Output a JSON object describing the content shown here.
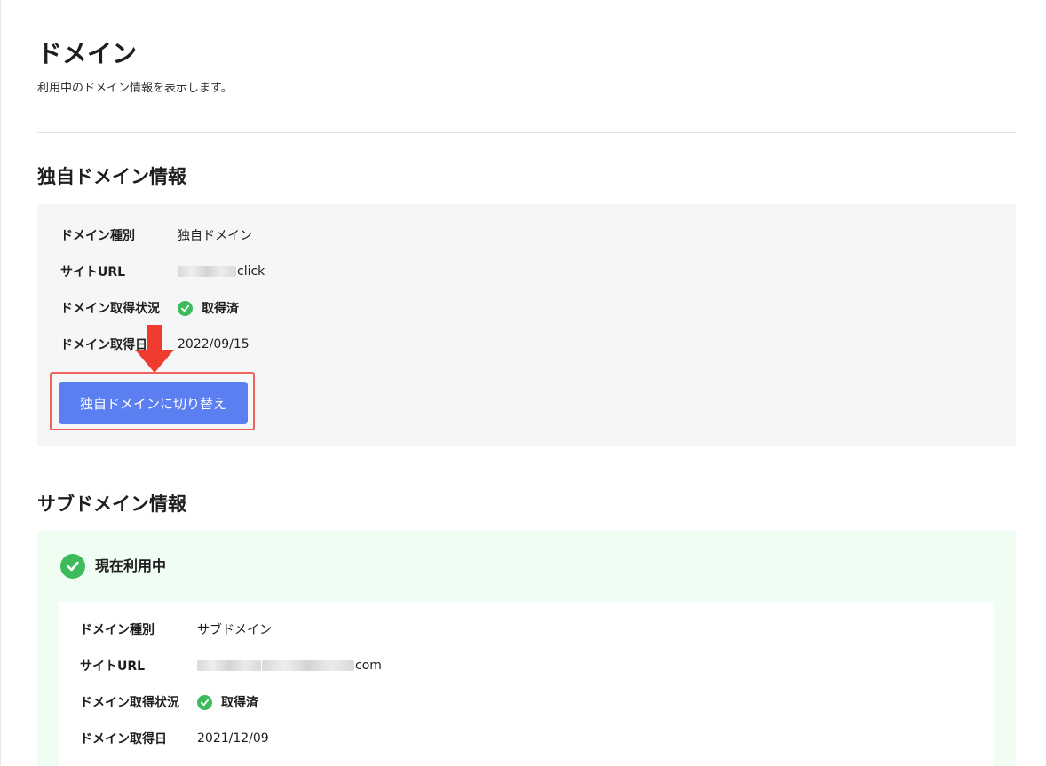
{
  "page": {
    "title": "ドメイン",
    "description": "利用中のドメイン情報を表示します。"
  },
  "custom_domain": {
    "section_title": "独自ドメイン情報",
    "rows": [
      {
        "label": "ドメイン種別",
        "value": "独自ドメイン"
      },
      {
        "label": "サイトURL",
        "value": "click"
      },
      {
        "label": "ドメイン取得状況",
        "value": "取得済"
      },
      {
        "label": "ドメイン取得日",
        "value": "2022/09/15"
      }
    ],
    "switch_button_label": "独自ドメインに切り替え"
  },
  "subdomain": {
    "section_title": "サブドメイン情報",
    "status_label": "現在利用中",
    "rows": [
      {
        "label": "ドメイン種別",
        "value": "サブドメイン"
      },
      {
        "label": "サイトURL",
        "value": "com"
      },
      {
        "label": "ドメイン取得状況",
        "value": "取得済"
      },
      {
        "label": "ドメイン取得日",
        "value": "2021/12/09"
      }
    ]
  },
  "colors": {
    "accent_button": "#5b7ff0",
    "highlight_border": "#f0625a",
    "arrow": "#f03c2e",
    "success": "#3dbb5a",
    "gray_panel": "#f5f6f8",
    "green_panel": "#f0fdf2"
  },
  "icons": {
    "status_check": "check-circle-icon",
    "annotation_arrow": "arrow-down-icon"
  }
}
